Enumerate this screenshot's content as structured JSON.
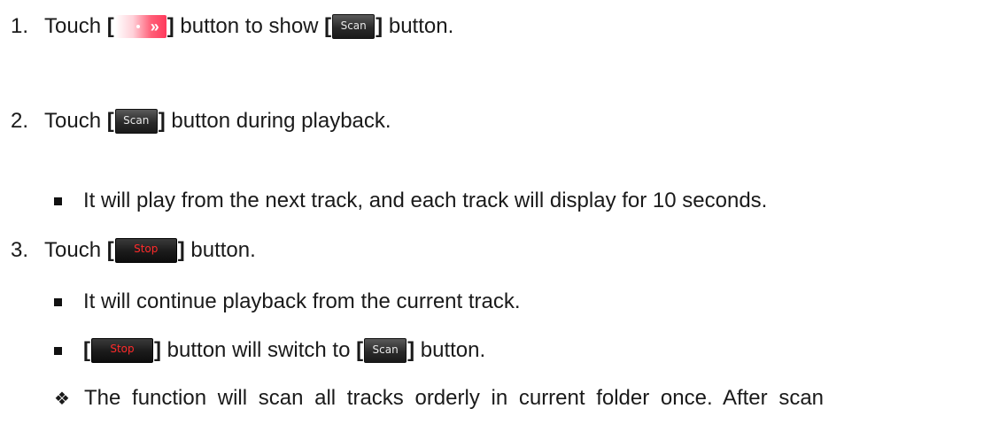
{
  "steps": [
    {
      "number": "1.",
      "pre": "Touch ",
      "mid": " button to show ",
      "post": " button."
    },
    {
      "number": "2.",
      "pre": "Touch ",
      "post": " button during playback."
    },
    {
      "number": "3.",
      "pre": "Touch ",
      "post": " button."
    }
  ],
  "bullets": {
    "step2_note": "It will play from the next track, and each track will display for 10 seconds.",
    "step3_note1": "It will continue playback from the current track.",
    "step3_note2_mid": " button will switch to ",
    "step3_note2_post": " button."
  },
  "note": {
    "symbol": "❖",
    "text": "The function will scan all tracks orderly in current folder once. After scan"
  },
  "buttons": {
    "scan_label": "Scan",
    "stop_label": "Stop",
    "next_glyph": "»"
  },
  "brackets": {
    "open": "[",
    "close": "]"
  },
  "colors": {
    "stop_text": "#ff2a2a",
    "next_button": "#ff3a5c"
  }
}
